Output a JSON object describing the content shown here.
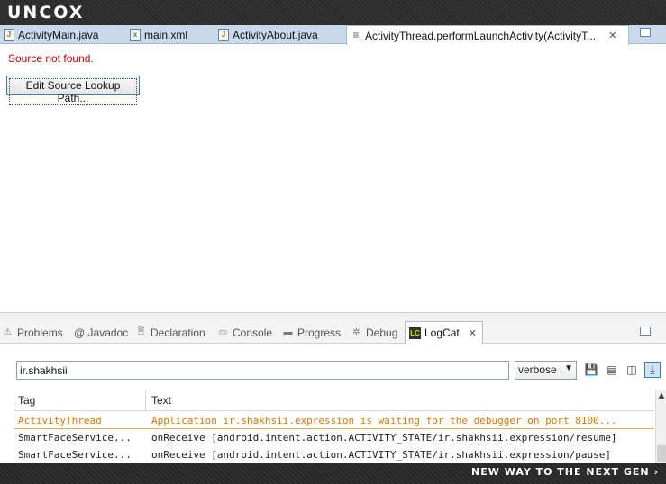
{
  "brand": {
    "logo": "UNCOX",
    "tagline": "NEW WAY TO THE NEXT GEN ›"
  },
  "editor_tabs": [
    {
      "label": "ActivityMain.java",
      "icon": "J"
    },
    {
      "label": "main.xml",
      "icon": "x"
    },
    {
      "label": "ActivityAbout.java",
      "icon": "J"
    },
    {
      "label": "ActivityThread.performLaunchActivity(ActivityT...",
      "icon": "≡",
      "close": "✕"
    }
  ],
  "editor": {
    "message": "Source not found.",
    "button": "Edit Source Lookup Path..."
  },
  "view_tabs": [
    {
      "label": "Problems",
      "icon": "⚠"
    },
    {
      "label": "@ Javadoc",
      "icon": ""
    },
    {
      "label": "Declaration",
      "icon": "🗎"
    },
    {
      "label": "Console",
      "icon": "▭"
    },
    {
      "label": "Progress",
      "icon": "▬"
    },
    {
      "label": "Debug",
      "icon": "✲"
    },
    {
      "label": "LogCat",
      "icon": "LC",
      "close": "✕"
    }
  ],
  "logcat": {
    "filter": "ir.shakhsii",
    "level": "verbose",
    "columns": [
      "Tag",
      "Text"
    ],
    "rows": [
      {
        "tag": "ActivityThread",
        "text": "Application ir.shakhsii.expression is waiting for the debugger on port 8100...",
        "level": "warn"
      },
      {
        "tag": "SmartFaceService...",
        "text": "onReceive [android.intent.action.ACTIVITY_STATE/ir.shakhsii.expression/resume]",
        "level": "info"
      },
      {
        "tag": "SmartFaceService...",
        "text": "onReceive [android.intent.action.ACTIVITY_STATE/ir.shakhsii.expression/pause]",
        "level": "info"
      }
    ]
  },
  "colors": {
    "error": "#c00000",
    "warn": "#e07800",
    "tab_bar": "#c9d9ec"
  }
}
